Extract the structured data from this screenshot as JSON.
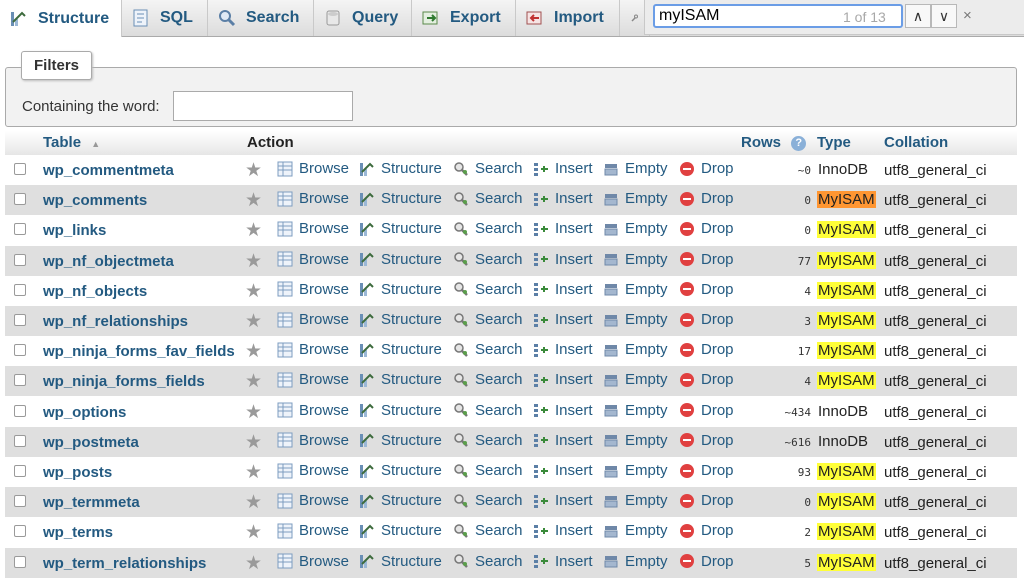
{
  "tabs": [
    {
      "label": "Structure",
      "icon": "structure-icon",
      "active": true
    },
    {
      "label": "SQL",
      "icon": "sql-icon"
    },
    {
      "label": "Search",
      "icon": "search-icon"
    },
    {
      "label": "Query",
      "icon": "query-icon"
    },
    {
      "label": "Export",
      "icon": "export-icon"
    },
    {
      "label": "Import",
      "icon": "import-icon"
    }
  ],
  "find": {
    "query": "myISAM",
    "count": "1 of 13",
    "prev": "∧",
    "next": "∨",
    "close": "×"
  },
  "filters": {
    "legend": "Filters",
    "label": "Containing the word:",
    "value": ""
  },
  "headers": {
    "table": "Table",
    "sort": "▲",
    "action": "Action",
    "rows": "Rows",
    "type": "Type",
    "collation": "Collation"
  },
  "actions": [
    "Browse",
    "Structure",
    "Search",
    "Insert",
    "Empty",
    "Drop"
  ],
  "rows": [
    {
      "name": "wp_commentmeta",
      "rows": "~0",
      "type": "InnoDB",
      "collation": "utf8_general_ci",
      "highlight": "none"
    },
    {
      "name": "wp_comments",
      "rows": "0",
      "type": "MyISAM",
      "collation": "utf8_general_ci",
      "highlight": "current"
    },
    {
      "name": "wp_links",
      "rows": "0",
      "type": "MyISAM",
      "collation": "utf8_general_ci",
      "highlight": "match"
    },
    {
      "name": "wp_nf_objectmeta",
      "rows": "77",
      "type": "MyISAM",
      "collation": "utf8_general_ci",
      "highlight": "match"
    },
    {
      "name": "wp_nf_objects",
      "rows": "4",
      "type": "MyISAM",
      "collation": "utf8_general_ci",
      "highlight": "match"
    },
    {
      "name": "wp_nf_relationships",
      "rows": "3",
      "type": "MyISAM",
      "collation": "utf8_general_ci",
      "highlight": "match"
    },
    {
      "name": "wp_ninja_forms_fav_fields",
      "rows": "17",
      "type": "MyISAM",
      "collation": "utf8_general_ci",
      "highlight": "match"
    },
    {
      "name": "wp_ninja_forms_fields",
      "rows": "4",
      "type": "MyISAM",
      "collation": "utf8_general_ci",
      "highlight": "match"
    },
    {
      "name": "wp_options",
      "rows": "~434",
      "type": "InnoDB",
      "collation": "utf8_general_ci",
      "highlight": "none"
    },
    {
      "name": "wp_postmeta",
      "rows": "~616",
      "type": "InnoDB",
      "collation": "utf8_general_ci",
      "highlight": "none"
    },
    {
      "name": "wp_posts",
      "rows": "93",
      "type": "MyISAM",
      "collation": "utf8_general_ci",
      "highlight": "match"
    },
    {
      "name": "wp_termmeta",
      "rows": "0",
      "type": "MyISAM",
      "collation": "utf8_general_ci",
      "highlight": "match"
    },
    {
      "name": "wp_terms",
      "rows": "2",
      "type": "MyISAM",
      "collation": "utf8_general_ci",
      "highlight": "match"
    },
    {
      "name": "wp_term_relationships",
      "rows": "5",
      "type": "MyISAM",
      "collation": "utf8_general_ci",
      "highlight": "match"
    }
  ]
}
